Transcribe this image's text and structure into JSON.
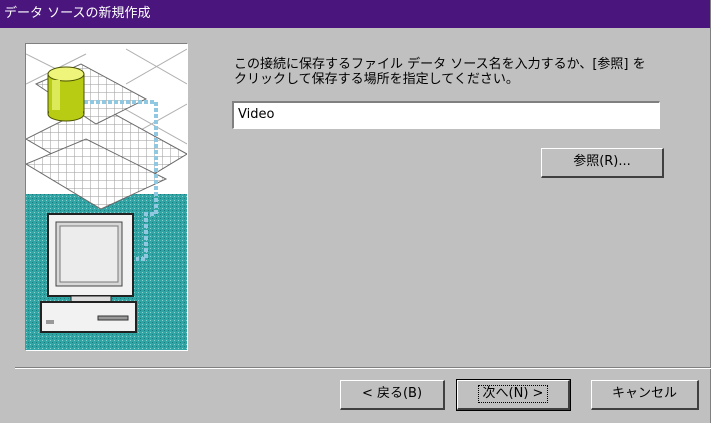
{
  "window": {
    "title": "データ ソースの新規作成"
  },
  "instruction": "この接続に保存するファイル データ ソース名を入力するか、[参照] を\nクリックして保存する場所を指定してください。",
  "name_field": {
    "value": "Video"
  },
  "buttons": {
    "browse": "参照(R)...",
    "back": "< 戻る(B)",
    "next": "次へ(N) >",
    "cancel": "キャンセル"
  },
  "colors": {
    "titlebar": "#4a157c",
    "face": "#c0c0c0",
    "teal": "#2fa5a5",
    "cylinder": "#c8dc1e"
  }
}
